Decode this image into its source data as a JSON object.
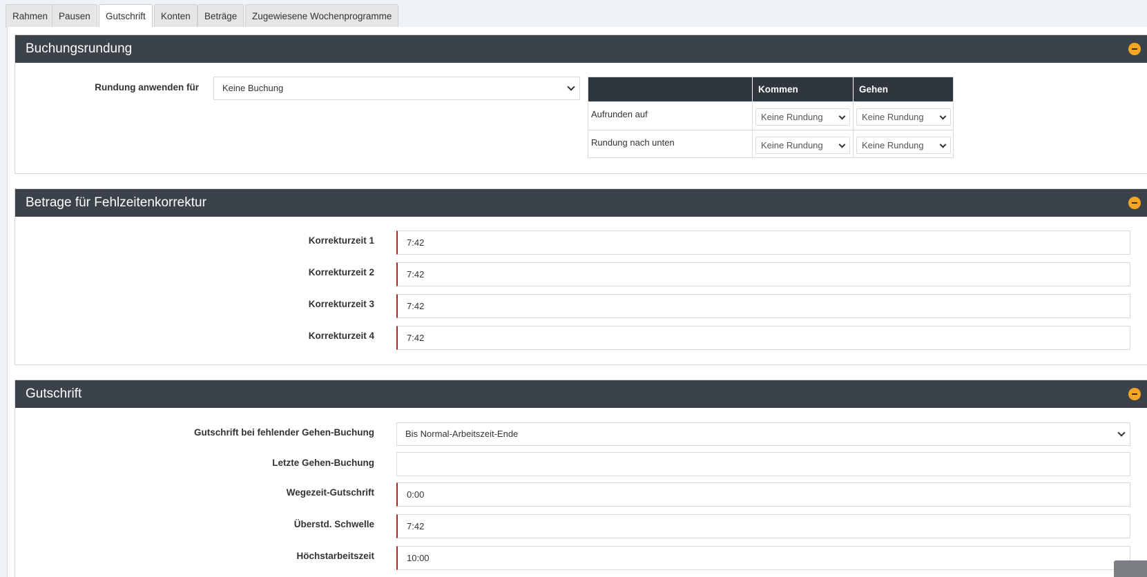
{
  "tabs": [
    "Rahmen",
    "Pausen",
    "Gutschrift",
    "Konten",
    "Beträge",
    "Zugewiesene Wochenprogramme"
  ],
  "active_tab": "Gutschrift",
  "buchungsrundung": {
    "title": "Buchungsrundung",
    "apply_label": "Rundung anwenden für",
    "apply_value": "Keine Buchung",
    "table": {
      "headers": [
        "",
        "Kommen",
        "Gehen"
      ],
      "rows": [
        {
          "label": "Aufrunden auf",
          "kommen": "Keine Rundung",
          "gehen": "Keine Rundung"
        },
        {
          "label": "Rundung nach unten",
          "kommen": "Keine Rundung",
          "gehen": "Keine Rundung"
        }
      ]
    }
  },
  "fehlzeiten": {
    "title": "Betrage für Fehlzeitenkorrektur",
    "fields": [
      {
        "label": "Korrekturzeit 1",
        "value": "7:42"
      },
      {
        "label": "Korrekturzeit 2",
        "value": "7:42"
      },
      {
        "label": "Korrekturzeit 3",
        "value": "7:42"
      },
      {
        "label": "Korrekturzeit 4",
        "value": "7:42"
      }
    ]
  },
  "gutschrift": {
    "title": "Gutschrift",
    "fehlend_label": "Gutschrift bei fehlender Gehen-Buchung",
    "fehlend_value": "Bis Normal-Arbeitszeit-Ende",
    "letzte_label": "Letzte Gehen-Buchung",
    "letzte_value": "",
    "wegezeit_label": "Wegezeit-Gutschrift",
    "wegezeit_value": "0:00",
    "schwelle_label": "Überstd. Schwelle",
    "schwelle_value": "7:42",
    "hoechst_label": "Höchstarbeitszeit",
    "hoechst_value": "10:00"
  },
  "colors": {
    "header_bg": "#3b4249",
    "accent_orange": "#f5a623",
    "required_border": "#b22222"
  },
  "icons": [
    "expand-icon",
    "collapse-icon",
    "chevron-down-icon"
  ]
}
